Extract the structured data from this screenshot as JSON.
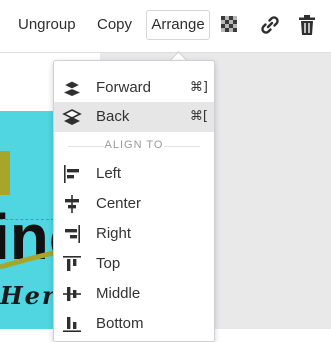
{
  "toolbar": {
    "ungroup_label": "Ungroup",
    "copy_label": "Copy",
    "arrange_label": "Arrange",
    "icons": [
      "transparency-icon",
      "link-icon",
      "trash-icon"
    ]
  },
  "canvas": {
    "art_text": "inc",
    "here_text": "Here",
    "background_color": "#4fd6e0"
  },
  "arrange_menu": {
    "items": [
      {
        "label": "Forward",
        "shortcut": "⌘]",
        "icon": "bring-forward-icon"
      },
      {
        "label": "Back",
        "shortcut": "⌘[",
        "icon": "send-back-icon"
      }
    ],
    "section_title": "ALIGN TO",
    "align_items": [
      {
        "label": "Left",
        "icon": "align-left-icon"
      },
      {
        "label": "Center",
        "icon": "align-center-icon"
      },
      {
        "label": "Right",
        "icon": "align-right-icon"
      },
      {
        "label": "Top",
        "icon": "align-top-icon"
      },
      {
        "label": "Middle",
        "icon": "align-middle-icon"
      },
      {
        "label": "Bottom",
        "icon": "align-bottom-icon"
      }
    ]
  }
}
